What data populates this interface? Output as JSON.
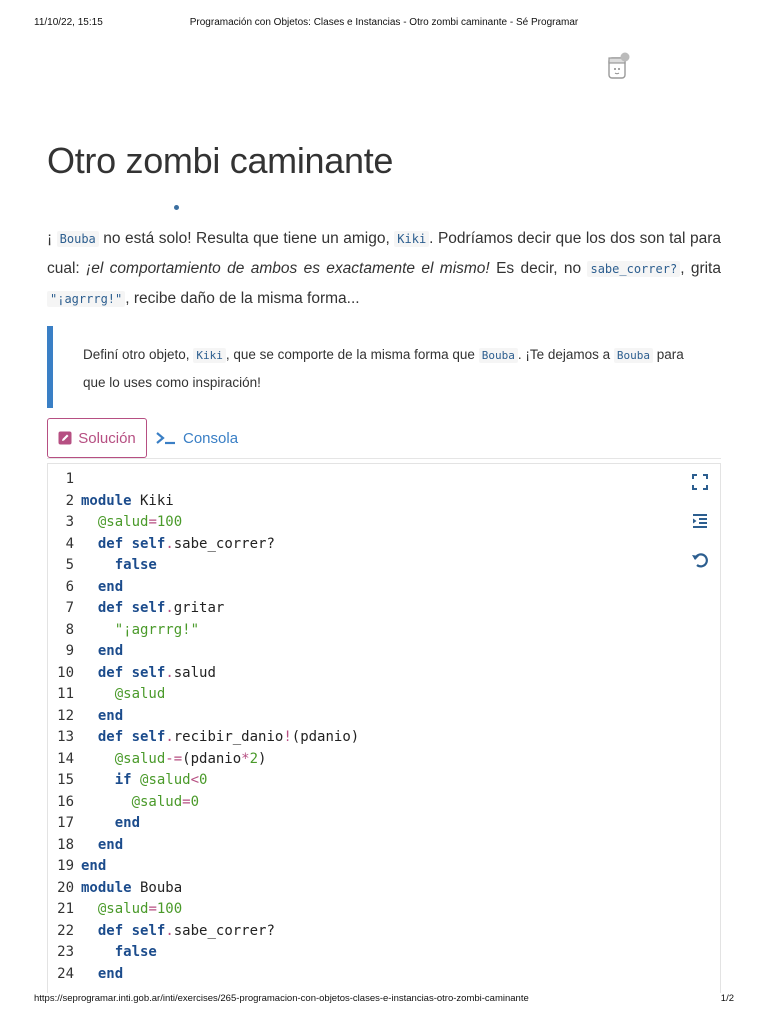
{
  "print": {
    "date": "11/10/22, 15:15",
    "title": "Programación con Objetos: Clases e Instancias - Otro zombi caminante - Sé Programar",
    "url": "https://seprogramar.inti.gob.ar/inti/exercises/265-programacion-con-objetos-clases-e-instancias-otro-zombi-caminante",
    "page": "1/2"
  },
  "exercise": {
    "title": "Otro zombi caminante",
    "intro": {
      "t1": "¡ ",
      "c1": "Bouba",
      "t2": " no está solo! Resulta que tiene un amigo, ",
      "c2": "Kiki",
      "t3": ". Podríamos decir que los dos son tal para cual: ",
      "em": "¡el comportamiento de ambos es exactamente el mismo!",
      "t4": " Es decir, no ",
      "c3": "sabe_correr?",
      "t5": ", grita ",
      "c4": "\"¡agrrrg!\"",
      "t6": ", recibe daño de la misma forma..."
    },
    "task": {
      "t1": "Definí otro objeto, ",
      "c1": "Kiki",
      "t2": ", que se comporte de la misma forma que ",
      "c2": "Bouba",
      "t3": ". ¡Te dejamos a ",
      "c3": "Bouba",
      "t4": " para que lo uses como inspiración!"
    }
  },
  "tabs": {
    "solution": "Solución",
    "console": "Consola"
  },
  "editor": {
    "lines": [
      {
        "n": "1",
        "tokens": []
      },
      {
        "n": "2",
        "tokens": [
          {
            "c": "kw",
            "t": "module"
          },
          {
            "c": "plain",
            "t": " Kiki"
          }
        ]
      },
      {
        "n": "3",
        "tokens": [
          {
            "c": "plain",
            "t": "  "
          },
          {
            "c": "iv",
            "t": "@salud"
          },
          {
            "c": "op",
            "t": "="
          },
          {
            "c": "num",
            "t": "100"
          }
        ]
      },
      {
        "n": "4",
        "tokens": [
          {
            "c": "plain",
            "t": "  "
          },
          {
            "c": "kw",
            "t": "def"
          },
          {
            "c": "plain",
            "t": " "
          },
          {
            "c": "sf",
            "t": "self"
          },
          {
            "c": "op",
            "t": "."
          },
          {
            "c": "plain",
            "t": "sabe_correr?"
          }
        ]
      },
      {
        "n": "5",
        "tokens": [
          {
            "c": "plain",
            "t": "    "
          },
          {
            "c": "kw",
            "t": "false"
          }
        ]
      },
      {
        "n": "6",
        "tokens": [
          {
            "c": "plain",
            "t": "  "
          },
          {
            "c": "kw",
            "t": "end"
          }
        ]
      },
      {
        "n": "7",
        "tokens": [
          {
            "c": "plain",
            "t": "  "
          },
          {
            "c": "kw",
            "t": "def"
          },
          {
            "c": "plain",
            "t": " "
          },
          {
            "c": "sf",
            "t": "self"
          },
          {
            "c": "op",
            "t": "."
          },
          {
            "c": "plain",
            "t": "gritar"
          }
        ]
      },
      {
        "n": "8",
        "tokens": [
          {
            "c": "plain",
            "t": "    "
          },
          {
            "c": "str",
            "t": "\"¡agrrrg!\""
          }
        ]
      },
      {
        "n": "9",
        "tokens": [
          {
            "c": "plain",
            "t": "  "
          },
          {
            "c": "kw",
            "t": "end"
          }
        ]
      },
      {
        "n": "10",
        "tokens": [
          {
            "c": "plain",
            "t": "  "
          },
          {
            "c": "kw",
            "t": "def"
          },
          {
            "c": "plain",
            "t": " "
          },
          {
            "c": "sf",
            "t": "self"
          },
          {
            "c": "op",
            "t": "."
          },
          {
            "c": "plain",
            "t": "salud"
          }
        ]
      },
      {
        "n": "11",
        "tokens": [
          {
            "c": "plain",
            "t": "    "
          },
          {
            "c": "iv",
            "t": "@salud"
          }
        ]
      },
      {
        "n": "12",
        "tokens": [
          {
            "c": "plain",
            "t": "  "
          },
          {
            "c": "kw",
            "t": "end"
          }
        ]
      },
      {
        "n": "13",
        "tokens": [
          {
            "c": "plain",
            "t": "  "
          },
          {
            "c": "kw",
            "t": "def"
          },
          {
            "c": "plain",
            "t": " "
          },
          {
            "c": "sf",
            "t": "self"
          },
          {
            "c": "op",
            "t": "."
          },
          {
            "c": "plain",
            "t": "recibir_danio"
          },
          {
            "c": "op",
            "t": "!"
          },
          {
            "c": "plain",
            "t": "(pdanio)"
          }
        ]
      },
      {
        "n": "14",
        "tokens": [
          {
            "c": "plain",
            "t": "    "
          },
          {
            "c": "iv",
            "t": "@salud"
          },
          {
            "c": "op",
            "t": "-="
          },
          {
            "c": "plain",
            "t": "(pdanio"
          },
          {
            "c": "op",
            "t": "*"
          },
          {
            "c": "num",
            "t": "2"
          },
          {
            "c": "plain",
            "t": ")"
          }
        ]
      },
      {
        "n": "15",
        "tokens": [
          {
            "c": "plain",
            "t": "    "
          },
          {
            "c": "kw",
            "t": "if"
          },
          {
            "c": "plain",
            "t": " "
          },
          {
            "c": "iv",
            "t": "@salud"
          },
          {
            "c": "op",
            "t": "<"
          },
          {
            "c": "num",
            "t": "0"
          }
        ]
      },
      {
        "n": "16",
        "tokens": [
          {
            "c": "plain",
            "t": "      "
          },
          {
            "c": "iv",
            "t": "@salud"
          },
          {
            "c": "op",
            "t": "="
          },
          {
            "c": "num",
            "t": "0"
          }
        ]
      },
      {
        "n": "17",
        "tokens": [
          {
            "c": "plain",
            "t": "    "
          },
          {
            "c": "kw",
            "t": "end"
          }
        ]
      },
      {
        "n": "18",
        "tokens": [
          {
            "c": "plain",
            "t": "  "
          },
          {
            "c": "kw",
            "t": "end"
          }
        ]
      },
      {
        "n": "19",
        "tokens": [
          {
            "c": "kw",
            "t": "end"
          }
        ]
      },
      {
        "n": "20",
        "tokens": [
          {
            "c": "kw",
            "t": "module"
          },
          {
            "c": "plain",
            "t": " Bouba"
          }
        ]
      },
      {
        "n": "21",
        "tokens": [
          {
            "c": "plain",
            "t": "  "
          },
          {
            "c": "iv",
            "t": "@salud"
          },
          {
            "c": "op",
            "t": "="
          },
          {
            "c": "num",
            "t": "100"
          }
        ]
      },
      {
        "n": "22",
        "tokens": [
          {
            "c": "plain",
            "t": "  "
          },
          {
            "c": "kw",
            "t": "def"
          },
          {
            "c": "plain",
            "t": " "
          },
          {
            "c": "sf",
            "t": "self"
          },
          {
            "c": "op",
            "t": "."
          },
          {
            "c": "plain",
            "t": "sabe_correr?"
          }
        ]
      },
      {
        "n": "23",
        "tokens": [
          {
            "c": "plain",
            "t": "    "
          },
          {
            "c": "kw",
            "t": "false"
          }
        ]
      },
      {
        "n": "24",
        "tokens": [
          {
            "c": "plain",
            "t": "  "
          },
          {
            "c": "kw",
            "t": "end"
          }
        ]
      }
    ]
  },
  "icons": {
    "mascot": "robot-mascot-icon",
    "solution": "pencil-square-icon",
    "console": "terminal-prompt-icon",
    "fullscreen": "fullscreen-icon",
    "indent": "indent-icon",
    "reset": "undo-icon"
  },
  "colors": {
    "accent_pink": "#b64f82",
    "accent_blue": "#3a7fc5",
    "keyword": "#1c4c8c",
    "literal": "#4a9a2a"
  }
}
